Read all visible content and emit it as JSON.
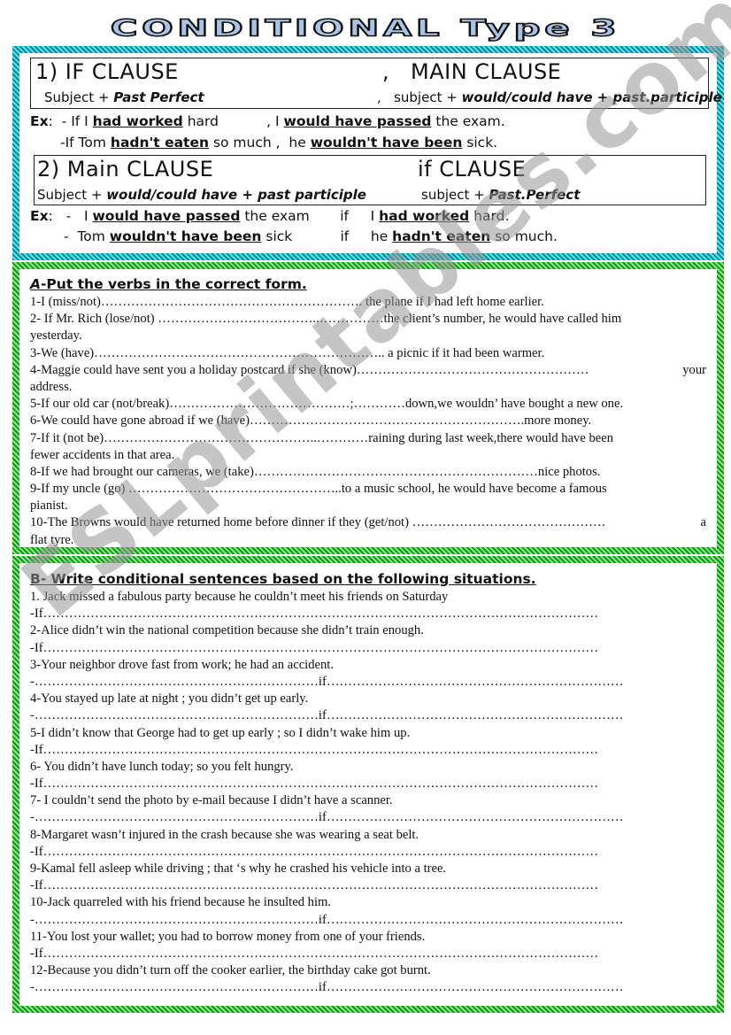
{
  "title": "CONDITIONAL Type 3",
  "watermark": "ESLprintables.com",
  "rules": {
    "rule1": {
      "if_clause": "1) IF CLAUSE",
      "comma": ",",
      "main_clause": "MAIN CLAUSE",
      "left_sub_plain": "Subject + ",
      "left_sub_bold": "Past Perfect",
      "right_comma": ",",
      "right_sub_plain": "subject + ",
      "right_sub_bold": "would/could have + past.participle"
    },
    "examples1": {
      "label": "Ex",
      "line1": {
        "a": ":  - If I ",
        "b": "had worked",
        "c": " hard           , I ",
        "d": "would have passed",
        "e": " the exam."
      },
      "line2": {
        "a": "-If Tom ",
        "b": "hadn't eaten",
        "c": " so much ,  he ",
        "d": "wouldn't have been",
        "e": " sick."
      }
    },
    "rule2": {
      "main_clause": "2) Main CLAUSE",
      "if_clause": "if CLAUSE",
      "left_sub_plain": "Subject + ",
      "left_sub_bold": "would/could have + past participle",
      "right_sub_plain": "subject +  ",
      "right_sub_bold": "Past.Perfect"
    },
    "examples2": {
      "label": "Ex",
      "line1": {
        "a": ":   -   I ",
        "b": "would have passed",
        "c": " the exam       if     I ",
        "d": "had worked",
        "e": " hard."
      },
      "line2": {
        "a": "-  Tom ",
        "b": "wouldn't have been",
        "c": " sick           if     he ",
        "d": "hadn't eaten",
        "e": " so much."
      }
    }
  },
  "section_a": {
    "title_letter": "A",
    "title_rest": "-Put the verbs in the correct form.",
    "lines": [
      {
        "l": "1-I  (miss/not)……………………………………………………. the plane if I  had left home earlier.",
        "r": ""
      },
      {
        "l": "2- If Mr. Rich (lose/not) ………………………………..……………the client’s number, he would have called him",
        "r": ""
      },
      {
        "l": "yesterday.",
        "r": ""
      },
      {
        "l": "3-We (have)………………………………………………………….. a picnic if it had been warmer.",
        "r": ""
      },
      {
        "l": "4-Maggie could have sent you a holiday postcard if she  (know)………………………………………………",
        "r": "your"
      },
      {
        "l": "address.",
        "r": ""
      },
      {
        "l": "5-If our old car (not/break)……………………………………;…………down,we wouldn’ have bought a new one.",
        "r": ""
      },
      {
        "l": "6-We could have gone abroad if we (have)……………………………………………………….more money.",
        "r": ""
      },
      {
        "l": "7-If it (not be)…………………………………………..…………raining during last week,there would have   been",
        "r": ""
      },
      {
        "l": "fewer accidents in that area.",
        "r": ""
      },
      {
        "l": "8-If we had brought our cameras, we (take)…………………………………………………………nice photos.",
        "r": ""
      },
      {
        "l": "9-If my uncle (go) …………………………………………..to a music school, he would have become a famous",
        "r": ""
      },
      {
        "l": "pianist.",
        "r": ""
      },
      {
        "l": "10-The Browns  would have returned  home before dinner if they (get/not) ………………………………………",
        "r": "a"
      },
      {
        "l": "flat tyre.",
        "r": ""
      }
    ]
  },
  "section_b": {
    "title": "B- Write conditional sentences based on the following situations.",
    "items": [
      {
        "prompt": "1. Jack missed a fabulous party because he couldn’t meet his friends on Saturday",
        "answer": "-If…………………………………………………………………………………………………………………"
      },
      {
        "prompt": "2-Alice didn’t win the national competition because she didn’t train enough.",
        "answer": "-If…………………………………………………………………………………………………………………"
      },
      {
        "prompt": "3-Your neighbor drove fast from work; he had an accident.",
        "answer": "-…………………………………………………………if……………………………………………………………"
      },
      {
        "prompt": "4-You stayed up late at night ; you didn’t get up early.",
        "answer": "-…………………………………………………………if……………………………………………………………"
      },
      {
        "prompt": "5-I  didn’t know that George had to get up early ; so I didn’t wake him up.",
        "answer": "-If…………………………………………………………………………………………………………………"
      },
      {
        "prompt": "6- You didn’t have lunch today; so you felt hungry.",
        "answer": "-If…………………………………………………………………………………………………………………"
      },
      {
        "prompt": "7- I couldn’t send the photo by e-mail because I didn’t have a scanner.",
        "answer": "-…………………………………………………………if……………………………………………………………"
      },
      {
        "prompt": "8-Margaret wasn’t injured in the crash because she was wearing a seat belt.",
        "answer": "-If…………………………………………………………………………………………………………………"
      },
      {
        "prompt": "9-Kamal fell asleep while driving ; that ‘s why he crashed his vehicle into a tree.",
        "answer": "-If…………………………………………………………………………………………………………………"
      },
      {
        "prompt": "10-Jack quarreled with his friend because he insulted him.",
        "answer": "-…………………………………………………………if……………………………………………………………"
      },
      {
        "prompt": "11-You lost your wallet;  you had to borrow money from one of your friends.",
        "answer": "-If…………………………………………………………………………………………………………………"
      },
      {
        "prompt": "12-Because you didn’t turn off the cooker earlier, the birthday cake got burnt.",
        "answer": "-…………………………………………………………if……………………………………………………………"
      }
    ]
  }
}
